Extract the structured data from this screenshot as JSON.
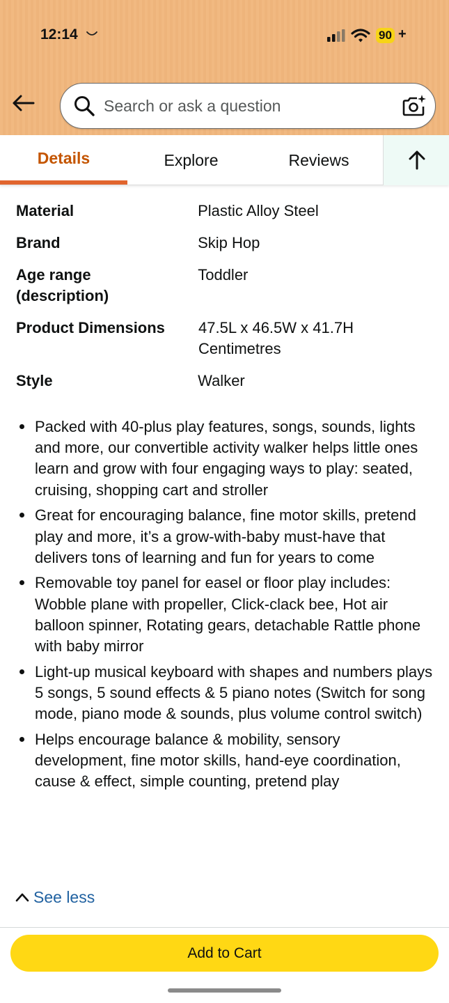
{
  "status_bar": {
    "time": "12:14",
    "battery": "90",
    "battery_plus": "+"
  },
  "search": {
    "placeholder": "Search or ask a question"
  },
  "tabs": [
    {
      "label": "Details",
      "active": true
    },
    {
      "label": "Explore",
      "active": false
    },
    {
      "label": "Reviews",
      "active": false
    }
  ],
  "specs": [
    {
      "label": "Material",
      "value": "Plastic Alloy Steel"
    },
    {
      "label": "Brand",
      "value": "Skip Hop"
    },
    {
      "label": "Age range (description)",
      "value": "Toddler"
    },
    {
      "label": "Product Dimensions",
      "value": "47.5L x 46.5W x 41.7H Centimetres"
    },
    {
      "label": "Style",
      "value": "Walker"
    }
  ],
  "bullets": [
    "Packed with 40-plus play features, songs, sounds, lights and more, our convertible activity walker helps little ones learn and grow with four engaging ways to play: seated, cruising, shopping cart and stroller",
    "Great for encouraging balance, fine motor skills, pretend play and more, it’s a grow-with-baby must-have that delivers tons of learning and fun for years to come",
    "Removable toy panel for easel or floor play includes: Wobble plane with propeller, Click-clack bee, Hot air balloon spinner, Rotating gears, detachable Rattle phone with baby mirror",
    "Light-up musical keyboard with shapes and numbers plays 5 songs, 5 sound effects & 5 piano notes (Switch for song mode, piano mode & sounds, plus volume control switch)",
    "Helps encourage balance & mobility, sensory development, fine motor skills, hand-eye coordination, cause & effect, simple counting, pretend play"
  ],
  "see_less": "See less",
  "add_to_cart": "Add to Cart",
  "colors": {
    "header_bg": "#f1b981",
    "active_tab": "#c45500",
    "tab_underline": "#e1652e",
    "link": "#2162a1",
    "cart_button": "#ffd814",
    "battery_badge": "#f7d417"
  },
  "icons": [
    "back-arrow-icon",
    "search-icon",
    "camera-icon",
    "arrow-up-icon",
    "chevron-up-icon",
    "signal-icon",
    "wifi-icon",
    "moon-icon"
  ]
}
